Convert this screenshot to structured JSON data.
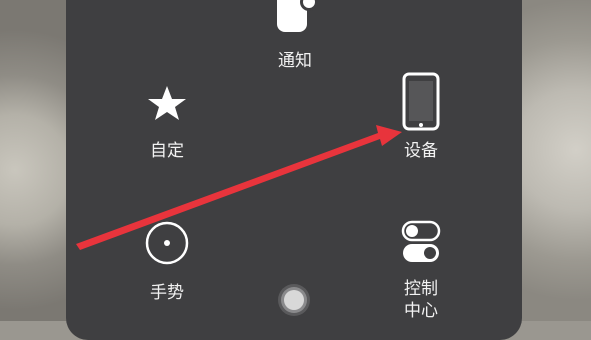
{
  "menu": {
    "notifications": {
      "label": "通知",
      "icon": "notification-icon"
    },
    "custom": {
      "label": "自定",
      "icon": "star-icon"
    },
    "device": {
      "label": "设备",
      "icon": "tablet-device-icon"
    },
    "gestures": {
      "label": "手势",
      "icon": "gesture-circle-icon"
    },
    "control_center": {
      "label_line1": "控制",
      "label_line2": "中心",
      "icon": "toggle-switches-icon"
    },
    "home": {
      "icon": "home-button-icon"
    }
  },
  "annotation": {
    "color": "#e8343c",
    "icon": "red-arrow-pointer"
  }
}
